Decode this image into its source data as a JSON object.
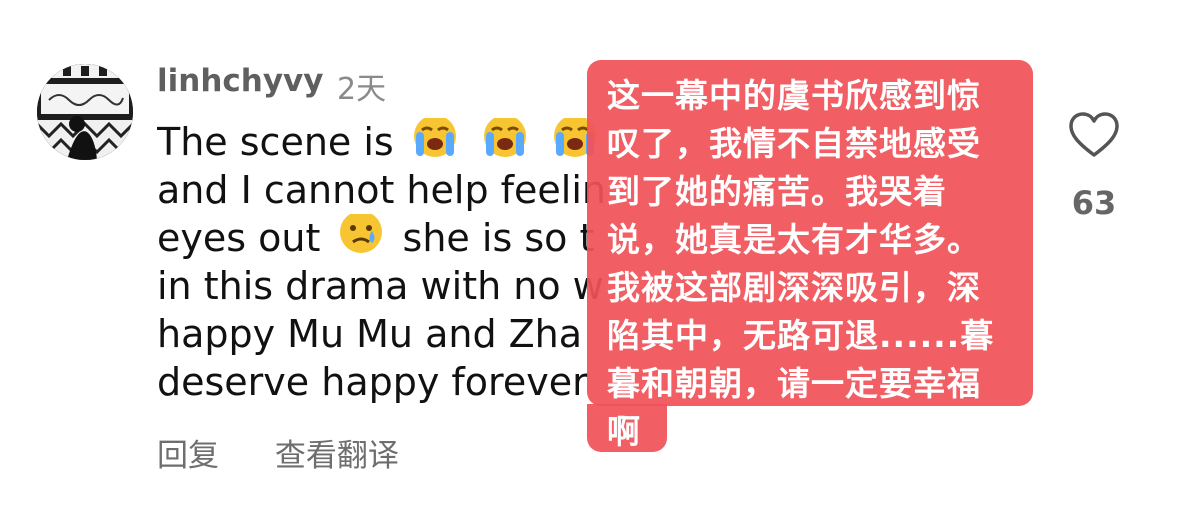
{
  "comment": {
    "username": "linhchyvy",
    "timestamp": "2天",
    "lines": {
      "l1": "The scene is",
      "l2": "and I cannot help feelin",
      "l3a": "eyes out",
      "l3b": "she is so t",
      "l4": "in this drama with no w",
      "l5": "happy Mu Mu and Zha",
      "l6": "deserve happy forever"
    },
    "emojis": [
      "loudly-crying-face",
      "loudly-crying-face",
      "loudly-crying-face",
      "crying-face"
    ],
    "reply_label": "回复",
    "translate_label": "查看翻译",
    "like_count": "63"
  },
  "translation": {
    "lines": [
      "这一幕中的虞书欣感到惊",
      "叹了，我情不自禁地感受",
      "到了她的痛苦。我哭着",
      "说，她真是太有才华多。",
      "我被这部剧深深吸引，深",
      "陷其中，无路可退......暮",
      "暮和朝朝，请一定要幸福",
      "啊"
    ]
  },
  "colors": {
    "overlay": "#f05258",
    "username": "#5f5f5f",
    "muted": "#8a8a8a"
  }
}
